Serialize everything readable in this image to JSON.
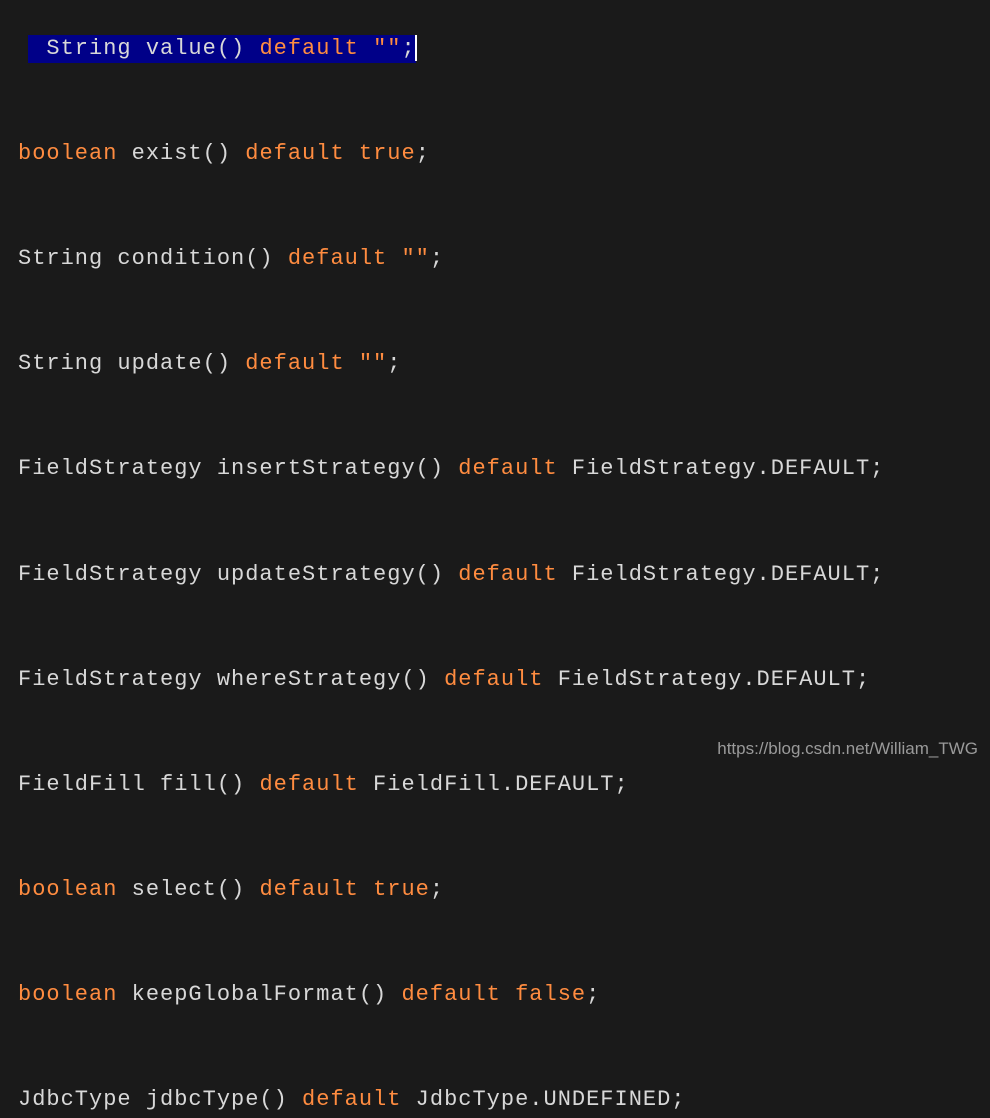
{
  "watermark": "https://blog.csdn.net/William_TWG",
  "lines": {
    "l1_a": "String value() ",
    "l1_b": "default",
    "l1_c": " \"\"",
    "l1_d": ";",
    "l2_a": "boolean",
    "l2_b": " exist() ",
    "l2_c": "default",
    "l2_d": " ",
    "l2_e": "true",
    "l2_f": ";",
    "l3_a": "String condition() ",
    "l3_b": "default",
    "l3_c": " \"\"",
    "l3_d": ";",
    "l4_a": "String update() ",
    "l4_b": "default",
    "l4_c": " \"\"",
    "l4_d": ";",
    "l5_a": "FieldStrategy insertStrategy() ",
    "l5_b": "default",
    "l5_c": " FieldStrategy.DEFAULT;",
    "l6_a": "FieldStrategy updateStrategy() ",
    "l6_b": "default",
    "l6_c": " FieldStrategy.DEFAULT;",
    "l7_a": "FieldStrategy whereStrategy() ",
    "l7_b": "default",
    "l7_c": " FieldStrategy.DEFAULT;",
    "l8_a": "FieldFill fill() ",
    "l8_b": "default",
    "l8_c": " FieldFill.DEFAULT;",
    "l9_a": "boolean",
    "l9_b": " select() ",
    "l9_c": "default",
    "l9_d": " ",
    "l9_e": "true",
    "l9_f": ";",
    "l10_a": "boolean",
    "l10_b": " keepGlobalFormat() ",
    "l10_c": "default",
    "l10_d": " ",
    "l10_e": "false",
    "l10_f": ";",
    "l11_a": "JdbcType jdbcType() ",
    "l11_b": "default",
    "l11_c": " JdbcType.UNDEFINED;"
  }
}
